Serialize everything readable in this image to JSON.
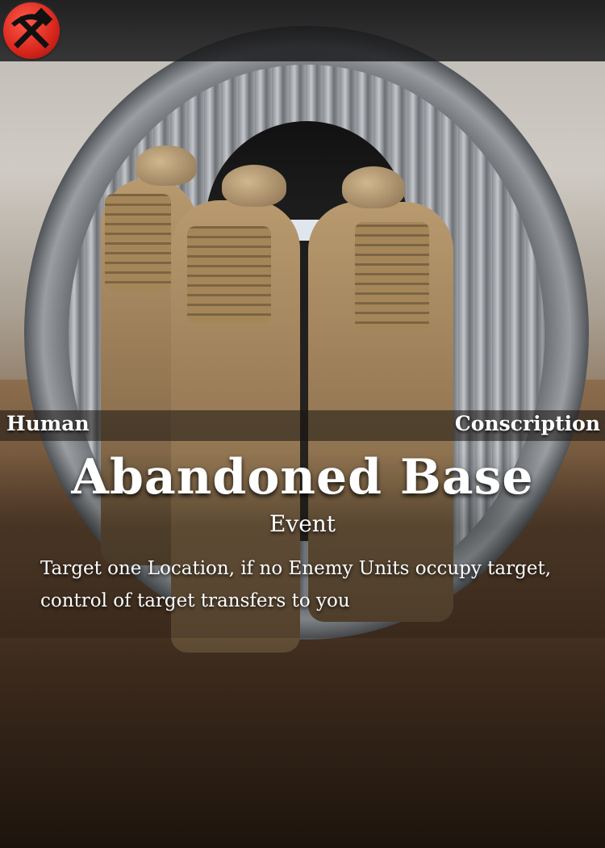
{
  "card": {
    "faction": "Human",
    "category": "Conscription",
    "name": "Abandoned Base",
    "type": "Event",
    "effect": "Target one Location, if no Enemy Units occupy target, control of target transfers to you",
    "logo_icon": "hammer-pick-icon",
    "accent_color": "#e0241b"
  }
}
